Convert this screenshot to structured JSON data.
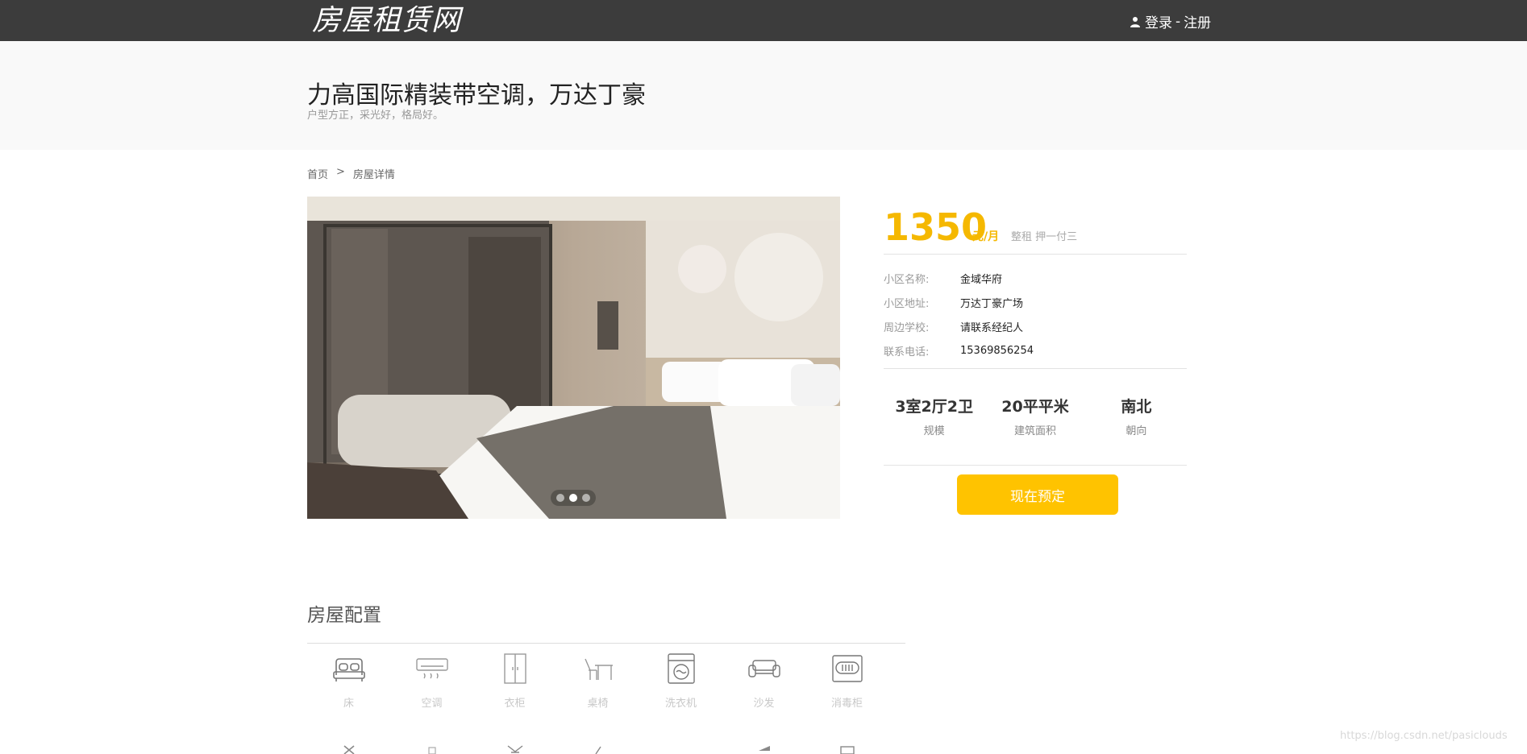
{
  "header": {
    "logo": "房屋租赁网",
    "login": "登录",
    "separator": "-",
    "register": "注册"
  },
  "listing": {
    "title": "力高国际精装带空调，万达丁豪",
    "subtitle": "户型方正，采光好，格局好。"
  },
  "breadcrumb": {
    "home": "首页",
    "sep": ">",
    "current": "房屋详情"
  },
  "gallery": {
    "slides": 3,
    "active_index": 1
  },
  "price": {
    "amount": "1350",
    "unit": "元/月",
    "terms": "整租 押一付三"
  },
  "details": [
    {
      "label": "小区名称:",
      "value": "金域华府"
    },
    {
      "label": "小区地址:",
      "value": "万达丁豪广场"
    },
    {
      "label": "周边学校:",
      "value": "请联系经纪人"
    },
    {
      "label": "联系电话:",
      "value": "15369856254"
    }
  ],
  "stats": [
    {
      "value": "3室2厅2卫",
      "label": "规模"
    },
    {
      "value": "20平平米",
      "label": "建筑面积"
    },
    {
      "value": "南北",
      "label": "朝向"
    }
  ],
  "reserve_label": "现在预定",
  "config": {
    "title": "房屋配置",
    "items": [
      {
        "label": "床",
        "icon": "bed-icon"
      },
      {
        "label": "空调",
        "icon": "air-conditioner-icon"
      },
      {
        "label": "衣柜",
        "icon": "wardrobe-icon"
      },
      {
        "label": "桌椅",
        "icon": "desk-chair-icon"
      },
      {
        "label": "洗衣机",
        "icon": "washing-machine-icon"
      },
      {
        "label": "沙发",
        "icon": "sofa-icon"
      },
      {
        "label": "消毒柜",
        "icon": "sterilizer-icon"
      }
    ]
  },
  "watermark": "https://blog.csdn.net/pasiclouds",
  "colors": {
    "topbar": "#3c3c3c",
    "accent": "#ffc300",
    "price": "#f5b800"
  }
}
